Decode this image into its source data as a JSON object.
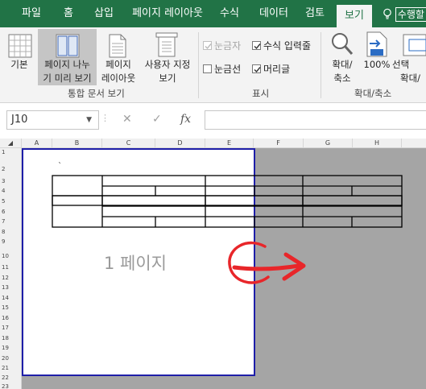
{
  "tabs": [
    {
      "label": "파일",
      "active": false
    },
    {
      "label": "홈",
      "active": false
    },
    {
      "label": "삽입",
      "active": false
    },
    {
      "label": "페이지 레이아웃",
      "active": false
    },
    {
      "label": "수식",
      "active": false
    },
    {
      "label": "데이터",
      "active": false
    },
    {
      "label": "검토",
      "active": false
    },
    {
      "label": "보기",
      "active": true
    }
  ],
  "tell_me": "수행할",
  "ribbon": {
    "workbook_views": {
      "buttons": [
        {
          "line1": "기본",
          "line2": "",
          "icon": "normal-view-icon"
        },
        {
          "line1": "페이지 나누",
          "line2": "기 미리 보기",
          "icon": "page-break-preview-icon",
          "selected": true
        },
        {
          "line1": "페이지",
          "line2": "레이아웃",
          "icon": "page-layout-icon"
        },
        {
          "line1": "사용자 지정",
          "line2": "보기",
          "icon": "custom-views-icon"
        }
      ],
      "group_label": "통합 문서 보기"
    },
    "show": {
      "checkboxes": [
        {
          "label": "눈금자",
          "checked": true,
          "disabled": true
        },
        {
          "label": "수식 입력줄",
          "checked": true,
          "disabled": false
        },
        {
          "label": "눈금선",
          "checked": false,
          "disabled": false
        },
        {
          "label": "머리글",
          "checked": true,
          "disabled": false
        }
      ],
      "group_label": "표시"
    },
    "zoom": {
      "buttons": [
        {
          "line1": "확대/",
          "line2": "축소",
          "icon": "zoom-magnifier-icon"
        },
        {
          "line1": "100%",
          "line2": "",
          "icon": "zoom-100-icon"
        },
        {
          "line1": "선택",
          "line2": "확대/",
          "icon": "zoom-to-selection-icon"
        }
      ],
      "group_label": "확대/축소"
    }
  },
  "formula_bar": {
    "name_box": "J10",
    "cancel_symbol": "✕",
    "enter_symbol": "✓",
    "fx_symbol": "fx",
    "formula_value": ""
  },
  "columns": [
    "A",
    "B",
    "C",
    "D",
    "E",
    "F",
    "G",
    "H"
  ],
  "rows": [
    "1",
    "2",
    "3",
    "4",
    "5",
    "6",
    "7",
    "8",
    "9",
    "10",
    "11",
    "12",
    "13",
    "14",
    "15",
    "16",
    "17",
    "18",
    "19",
    "20",
    "21",
    "22",
    "23"
  ],
  "sheet": {
    "page_label": "1 페이지",
    "b2_text": "`",
    "annotation": "red-arrow-circle-icon"
  }
}
